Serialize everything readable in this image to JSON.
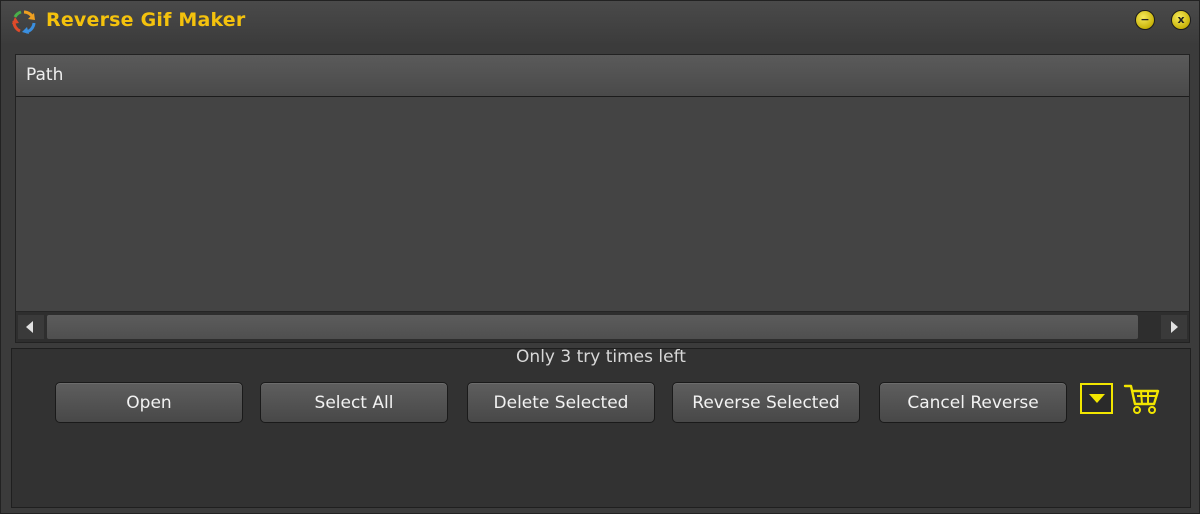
{
  "window": {
    "title": "Reverse Gif Maker",
    "minimize_label": "−",
    "close_label": "x"
  },
  "list": {
    "column_header": "Path",
    "rows": []
  },
  "status": {
    "message": "Only 3 try times left"
  },
  "toolbar": {
    "open_label": "Open",
    "select_all_label": "Select All",
    "delete_selected_label": "Delete Selected",
    "reverse_selected_label": "Reverse Selected",
    "cancel_reverse_label": "Cancel Reverse"
  },
  "icons": {
    "app": "recycle-arrows-icon",
    "dropdown": "chevron-down-icon",
    "cart": "shopping-cart-icon"
  },
  "colors": {
    "title_accent": "#f4c20d",
    "icon_accent": "#f2e600",
    "background": "#3b3b3b"
  }
}
